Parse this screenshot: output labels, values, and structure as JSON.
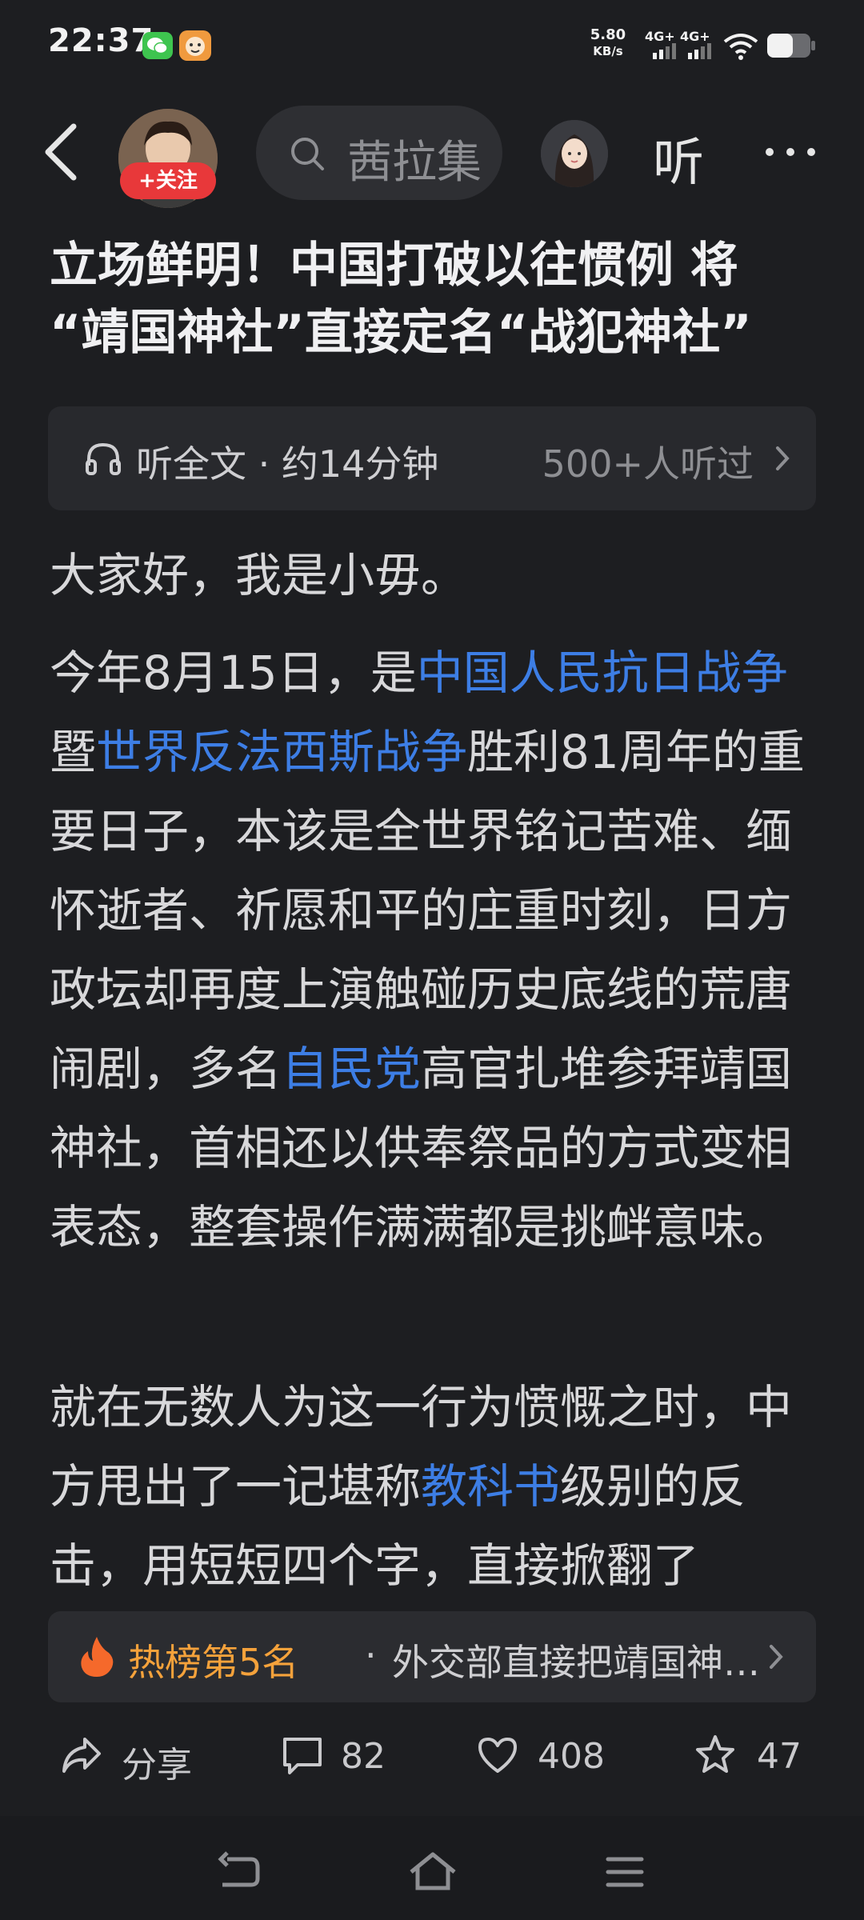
{
  "status_bar": {
    "time": "22:37",
    "net_speed_value": "5.80",
    "net_speed_unit": "KB/s",
    "signal1": "4G+",
    "signal2": "4G+",
    "icons": [
      "wechat-icon",
      "app-icon",
      "signal-icon",
      "wifi-icon",
      "battery-icon"
    ]
  },
  "nav": {
    "follow_label": "+关注",
    "search_text": "茜拉集",
    "listen_label": "听",
    "icons": [
      "back-icon",
      "author-avatar",
      "search-icon",
      "tts-avatar",
      "more-icon"
    ]
  },
  "article": {
    "title_line1": "立场鲜明！中国打破以往惯例 将",
    "title_line2": "“靖国神社”直接定名“战犯神社”",
    "listen_bar": {
      "text": "听全文 · 约14分钟",
      "count": "500+人听过"
    },
    "p1": "大家好，我是小毋。",
    "p2": {
      "t1": "今年8月15日，是",
      "link1": "中国人民抗日战争",
      "t2": "暨",
      "link2": "世界反法西斯战争",
      "t3": "胜利81周年的重要日子，本该是全世界铭记苦难、缅怀逝者、祈愿和平的庄重时刻，日方政坛却再度上演触碰历史底线的荒唐闹剧，多名",
      "link3": "自民党",
      "t4": "高官扎堆参拜靖国神社，首相还以供奉祭品的方式变相表态，整套操作满满都是挑衅意味。"
    },
    "p3": {
      "t1": "就在无数人为这一行为愤慨之时，中方甩出了一记堪称",
      "link1": "教科书",
      "t2": "级别的反击，用短短四个字，直接掀翻了"
    }
  },
  "hot_bar": {
    "rank": "热榜第5名",
    "separator": "·",
    "text": "外交部直接把靖国神…"
  },
  "actions": {
    "share": "分享",
    "comments": "82",
    "likes": "408",
    "favorites": "47"
  },
  "colors": {
    "background": "#1d1e21",
    "link": "#3d7ee5",
    "hot": "#f5a23b",
    "follow": "#e8383a"
  }
}
